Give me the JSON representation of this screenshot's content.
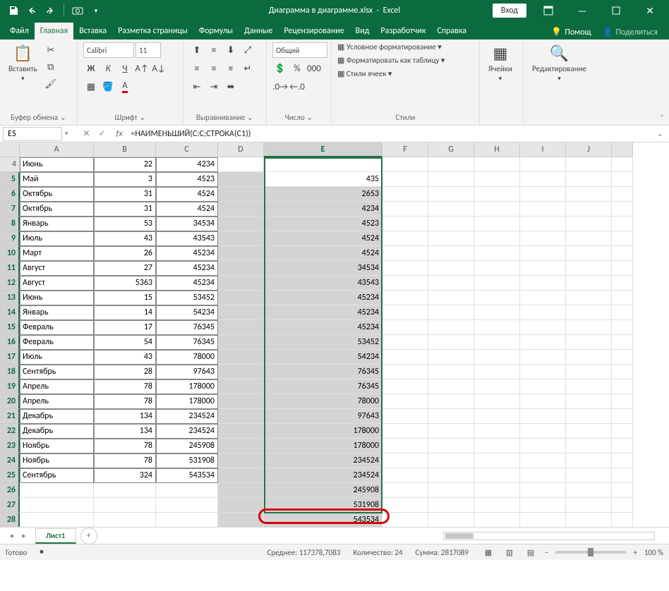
{
  "title": {
    "filename": "Диаграмма в диаграмме.xlsx",
    "app": "Excel",
    "login": "Вход"
  },
  "tabs": [
    "Файл",
    "Главная",
    "Вставка",
    "Разметка страницы",
    "Формулы",
    "Данные",
    "Рецензирование",
    "Вид",
    "Разработчик",
    "Справка"
  ],
  "active_tab": 1,
  "help": {
    "tellme": "Помощ",
    "share": "Поделиться"
  },
  "ribbon": {
    "clipboard": {
      "paste": "Вставить",
      "label": "Буфер обмена"
    },
    "font": {
      "name": "Calibri",
      "size": "11",
      "label": "Шрифт"
    },
    "align": {
      "label": "Выравнивание"
    },
    "number": {
      "format": "Общий",
      "label": "Число"
    },
    "styles": {
      "cond": "Условное форматирование",
      "table": "Форматировать как таблицу",
      "cellstyles": "Стили ячеек",
      "label": "Стили"
    },
    "cells": {
      "label": "Ячейки"
    },
    "editing": {
      "label": "Редактирование"
    }
  },
  "formula": {
    "cellref": "E5",
    "value": "=НАИМЕНЬШИЙ(C:C;СТРОКА(C1))"
  },
  "cols": [
    "A",
    "B",
    "C",
    "D",
    "E",
    "F",
    "G",
    "H",
    "I",
    "J"
  ],
  "rows": [
    {
      "n": 4,
      "a": "Июнь",
      "b": "22",
      "c": "4234",
      "e": ""
    },
    {
      "n": 5,
      "a": "Май",
      "b": "3",
      "c": "4523",
      "e": "435"
    },
    {
      "n": 6,
      "a": "Октябрь",
      "b": "31",
      "c": "4524",
      "e": "2653"
    },
    {
      "n": 7,
      "a": "Октябрь",
      "b": "31",
      "c": "4524",
      "e": "4234"
    },
    {
      "n": 8,
      "a": "Январь",
      "b": "53",
      "c": "34534",
      "e": "4523"
    },
    {
      "n": 9,
      "a": "Июль",
      "b": "43",
      "c": "43543",
      "e": "4524"
    },
    {
      "n": 10,
      "a": "Март",
      "b": "26",
      "c": "45234",
      "e": "4524"
    },
    {
      "n": 11,
      "a": "Август",
      "b": "27",
      "c": "45234",
      "e": "34534"
    },
    {
      "n": 12,
      "a": "Август",
      "b": "5363",
      "c": "45234",
      "e": "43543"
    },
    {
      "n": 13,
      "a": "Июнь",
      "b": "15",
      "c": "53452",
      "e": "45234"
    },
    {
      "n": 14,
      "a": "Январь",
      "b": "14",
      "c": "54234",
      "e": "45234"
    },
    {
      "n": 15,
      "a": "Февраль",
      "b": "17",
      "c": "76345",
      "e": "45234"
    },
    {
      "n": 16,
      "a": "Февраль",
      "b": "54",
      "c": "76345",
      "e": "53452"
    },
    {
      "n": 17,
      "a": "Июль",
      "b": "43",
      "c": "78000",
      "e": "54234"
    },
    {
      "n": 18,
      "a": "Сентябрь",
      "b": "28",
      "c": "97643",
      "e": "76345"
    },
    {
      "n": 19,
      "a": "Апрель",
      "b": "78",
      "c": "178000",
      "e": "76345"
    },
    {
      "n": 20,
      "a": "Апрель",
      "b": "78",
      "c": "178000",
      "e": "78000"
    },
    {
      "n": 21,
      "a": "Декабрь",
      "b": "134",
      "c": "234524",
      "e": "97643"
    },
    {
      "n": 22,
      "a": "Декабрь",
      "b": "134",
      "c": "234524",
      "e": "178000"
    },
    {
      "n": 23,
      "a": "Ноябрь",
      "b": "78",
      "c": "245908",
      "e": "178000"
    },
    {
      "n": 24,
      "a": "Ноябрь",
      "b": "78",
      "c": "531908",
      "e": "234524"
    },
    {
      "n": 25,
      "a": "Сентябрь",
      "b": "324",
      "c": "543534",
      "e": "234524"
    },
    {
      "n": 26,
      "a": "",
      "b": "",
      "c": "",
      "e": "245908"
    },
    {
      "n": 27,
      "a": "",
      "b": "",
      "c": "",
      "e": "531908"
    },
    {
      "n": 28,
      "a": "",
      "b": "",
      "c": "",
      "e": "543534"
    }
  ],
  "sheet": {
    "name": "Лист1"
  },
  "status": {
    "ready": "Готово",
    "avg_label": "Среднее:",
    "avg": "117378,7083",
    "count_label": "Количество:",
    "count": "24",
    "sum_label": "Сумма:",
    "sum": "2817089",
    "zoom": "100 %"
  }
}
